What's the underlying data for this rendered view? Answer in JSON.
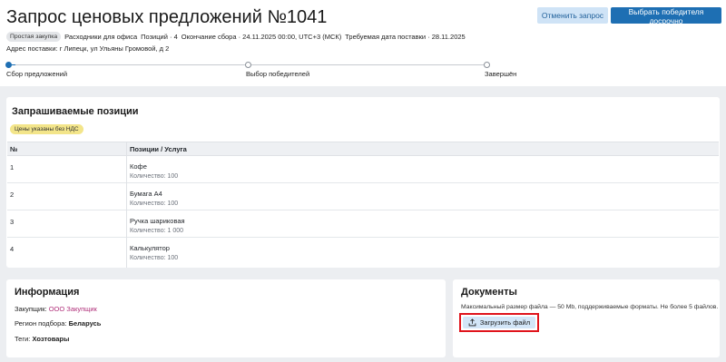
{
  "header": {
    "title": "Запрос ценовых предложений №1041",
    "cancel_label": "Отменить запрос",
    "winner_label": "Выбрать победителя досрочно",
    "badge": "Простая закупка",
    "category": "Расходники для офиса",
    "positions": "Позиций · 4",
    "deadline": "Окончание сбора · 24.11.2025 00:00, UTC+3 (МСК)",
    "delivery": "Требуемая дата поставки · 28.11.2025",
    "address_label": "Адрес поставки:",
    "address": "г Липецк, ул Ульяны Громовой, д 2"
  },
  "progress": {
    "steps": [
      {
        "label": "Сбор предложений",
        "state": "active"
      },
      {
        "label": "Выбор победителей",
        "state": "pending"
      },
      {
        "label": "Завершён",
        "state": "pending"
      }
    ]
  },
  "positions": {
    "title": "Запрашиваемые позиции",
    "vat_badge": "Цены указаны без НДС",
    "col_num": "№",
    "col_item": "Позиции / Услуга",
    "rows": [
      {
        "num": "1",
        "name": "Кофе",
        "qty": "Количество: 100"
      },
      {
        "num": "2",
        "name": "Бумага А4",
        "qty": "Количество: 100"
      },
      {
        "num": "3",
        "name": "Ручка шариковая",
        "qty": "Количество: 1 000"
      },
      {
        "num": "4",
        "name": "Калькулятор",
        "qty": "Количество: 100"
      }
    ]
  },
  "info": {
    "title": "Информация",
    "customer_label": "Закупщик:",
    "customer_value": "ООО Закупщик",
    "region_label": "Регион подбора:",
    "region_value": "Беларусь",
    "tags_label": "Теги:",
    "tags_value": "Хозтовары"
  },
  "documents": {
    "title": "Документы",
    "note": "Максимальный размер файла — 50 Mb, поддерживаемые форматы. Не более 5 файлов.",
    "upload_label": "Загрузить файл"
  },
  "colors": {
    "accent": "#1e6fb3",
    "highlight": "#e0141c",
    "link": "#b0307a"
  }
}
